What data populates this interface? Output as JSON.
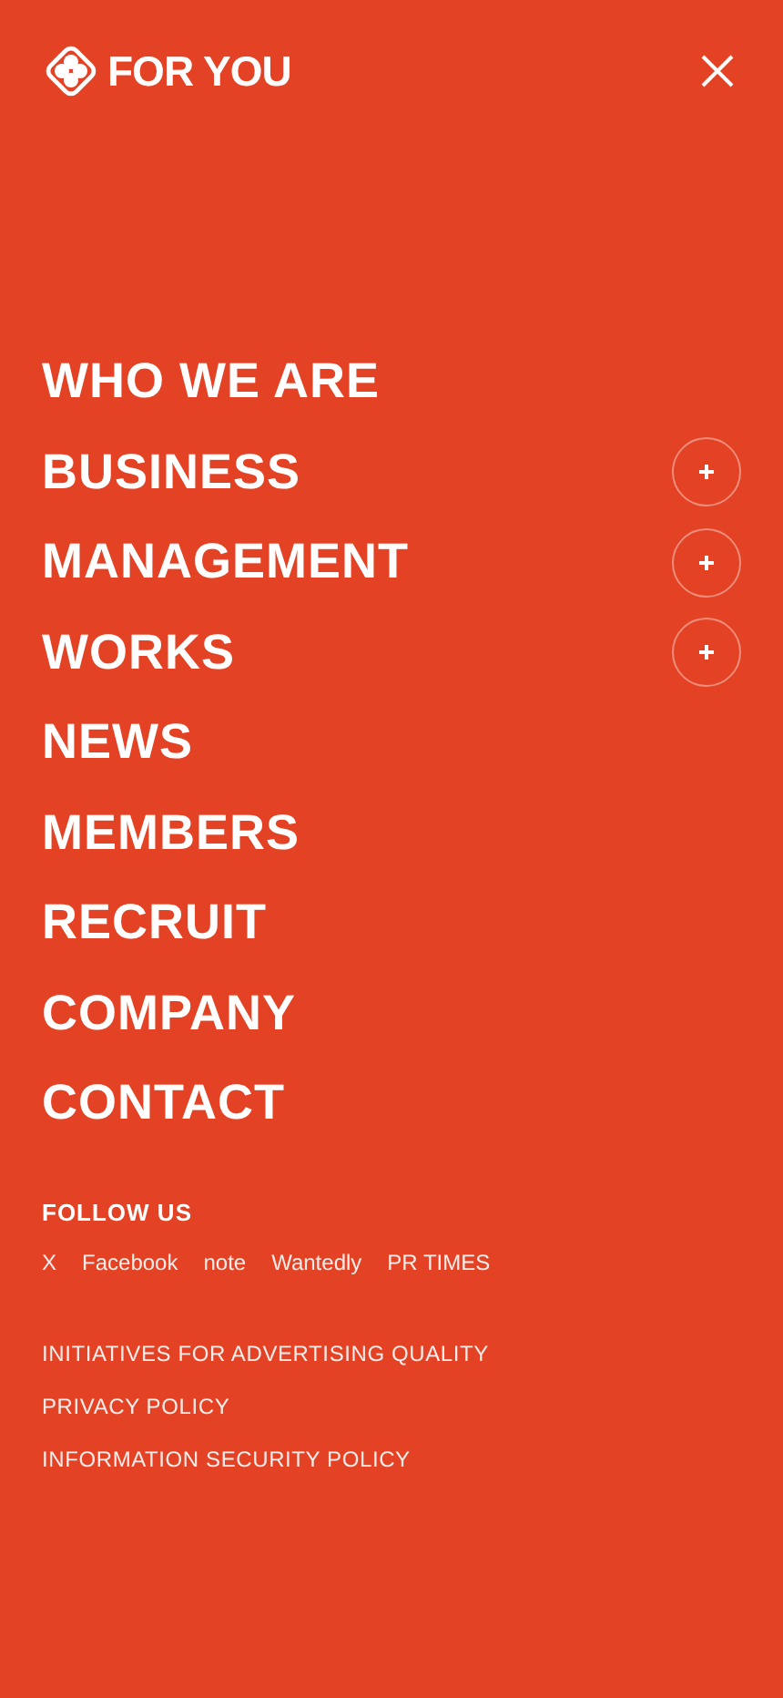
{
  "header": {
    "logo_text": "FOR YOU"
  },
  "menu": [
    {
      "label": "WHO WE ARE",
      "expandable": false
    },
    {
      "label": "BUSINESS",
      "expandable": true
    },
    {
      "label": "MANAGEMENT",
      "expandable": true
    },
    {
      "label": "WORKS",
      "expandable": true
    },
    {
      "label": "NEWS",
      "expandable": false
    },
    {
      "label": "MEMBERS",
      "expandable": false
    },
    {
      "label": "RECRUIT",
      "expandable": false
    },
    {
      "label": "COMPANY",
      "expandable": false
    },
    {
      "label": "CONTACT",
      "expandable": false
    }
  ],
  "follow": {
    "title": "FOLLOW US",
    "links": [
      "X",
      "Facebook",
      "note",
      "Wantedly",
      "PR TIMES"
    ]
  },
  "policy_links": [
    "INITIATIVES FOR ADVERTISING QUALITY",
    "PRIVACY POLICY",
    "INFORMATION SECURITY POLICY"
  ]
}
